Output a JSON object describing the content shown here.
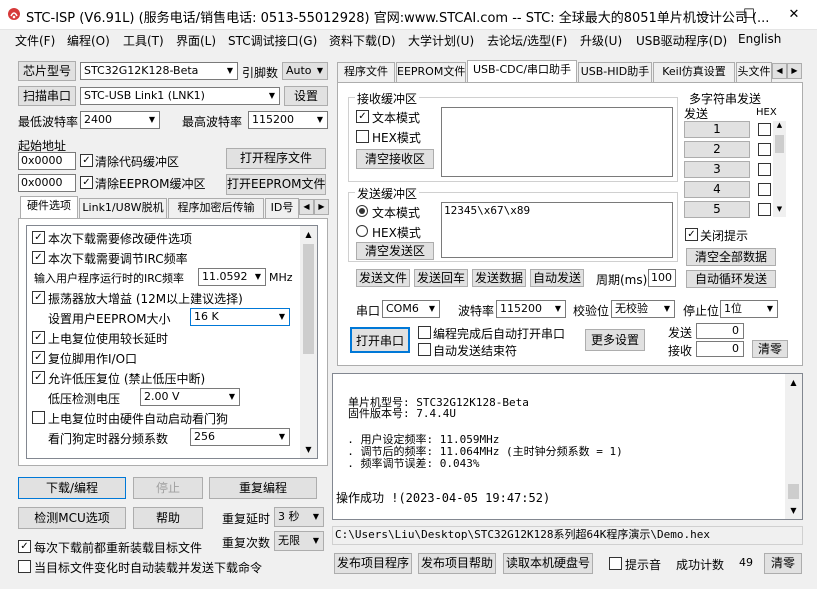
{
  "title": "STC-ISP (V6.91L) (服务电话/销售电话: 0513-55012928) 官网:www.STCAI.com -- STC: 全球最大的8051单片机设计公司 (...",
  "window_buttons": {
    "minimize": "—",
    "maximize": "☐",
    "close": "✕"
  },
  "menu": [
    "文件(F)",
    "编程(O)",
    "工具(T)",
    "界面(L)",
    "STC调试接口(G)",
    "资料下载(D)",
    "大学计划(U)",
    "去论坛/选型(F)",
    "升级(U)",
    "USB驱动程序(D)",
    "English"
  ],
  "left": {
    "chip_btn": "芯片型号",
    "chip_value": "STC32G12K128-Beta",
    "pin_label": "引脚数",
    "pin_value": "Auto",
    "scan_btn": "扫描串口",
    "port_value": "STC-USB Link1 (LNK1)",
    "settings_btn": "设置",
    "min_baud_label": "最低波特率",
    "min_baud": "2400",
    "max_baud_label": "最高波特率",
    "max_baud": "115200",
    "start_addr_label": "起始地址",
    "addr1": "0x0000",
    "clear_code": "清除代码缓冲区",
    "open_prog": "打开程序文件",
    "addr2": "0x0000",
    "clear_eeprom": "清除EEPROM缓冲区",
    "open_eeprom": "打开EEPROM文件",
    "tabs": [
      "硬件选项",
      "Link1/U8W脱机",
      "程序加密后传输",
      "ID号"
    ],
    "options": [
      {
        "label": "本次下载需要修改硬件选项",
        "checked": true
      },
      {
        "label": "本次下载需要调节IRC频率",
        "checked": true
      },
      {
        "label": "输入用户程序运行时的IRC频率",
        "value": "11.0592",
        "unit": "MHz"
      },
      {
        "label": "振荡器放大增益 (12M以上建议选择)",
        "checked": true
      },
      {
        "label": "设置用户EEPROM大小",
        "value": "16   K"
      },
      {
        "label": "上电复位使用较长延时",
        "checked": true
      },
      {
        "label": "复位脚用作I/O口",
        "checked": true
      },
      {
        "label": "允许低压复位 (禁止低压中断)",
        "checked": true
      },
      {
        "label": "低压检测电压",
        "value": "2.00 V"
      },
      {
        "label": "上电复位时由硬件自动启动看门狗",
        "checked": false
      },
      {
        "label": "看门狗定时器分频系数",
        "value": "256"
      }
    ],
    "download_btn": "下载/编程",
    "stop_btn": "停止",
    "reprogram_btn": "重复编程",
    "detect_btn": "检测MCU选项",
    "help_btn": "帮助",
    "repeat_delay_label": "重复延时",
    "repeat_delay": "3 秒",
    "repeat_count_label": "重复次数",
    "repeat_count": "无限",
    "reload_label": "每次下载前都重新装载目标文件",
    "reload_checked": true,
    "autoload_label": "当目标文件变化时自动装载并发送下载命令",
    "autoload_checked": false
  },
  "right": {
    "tabs": [
      "程序文件",
      "EEPROM文件",
      "USB-CDC/串口助手",
      "USB-HID助手",
      "Keil仿真设置",
      "头文件"
    ],
    "recv_group": "接收缓冲区",
    "text_mode": "文本模式",
    "hex_mode": "HEX模式",
    "clear_recv": "清空接收区",
    "send_group": "发送缓冲区",
    "send_text": "12345\\x67\\x89",
    "clear_send": "清空发送区",
    "send_file": "发送文件",
    "send_return": "发送回车",
    "send_data": "发送数据",
    "auto_send": "自动发送",
    "period_label": "周期(ms)",
    "period": "100",
    "multi_title": "多字符串发送",
    "send_col": "发送",
    "hex_col": "HEX",
    "multi_btns": [
      "1",
      "2",
      "3",
      "4",
      "5"
    ],
    "close_tip": "关闭提示",
    "clear_all": "清空全部数据",
    "auto_loop": "自动循环发送",
    "port_label": "串口",
    "port": "COM6",
    "baud_label": "波特率",
    "baud": "115200",
    "parity_label": "校验位",
    "parity": "无校验",
    "stop_label": "停止位",
    "stop": "1位",
    "open_port": "打开串口",
    "auto_open": "编程完成后自动打开串口",
    "auto_end": "自动发送结束符",
    "more_settings": "更多设置",
    "send_count_label": "发送",
    "send_count": "0",
    "recv_count_label": "接收",
    "recv_count": "0",
    "clear_count": "清零"
  },
  "log": {
    "lines": [
      "单片机型号: STC32G12K128-Beta",
      "固件版本号: 7.4.4U",
      "",
      "",
      "  . 用户设定频率: 11.059MHz",
      "  . 调节后的频率: 11.064MHz (主时钟分频系数 = 1)",
      "  . 频率调节误差: 0.043%"
    ],
    "result": "操作成功 !(2023-04-05 19:47:52)"
  },
  "path": "C:\\Users\\Liu\\Desktop\\STC32G12K128系列超64K程序演示\\Demo.hex",
  "bottom": {
    "publish_prog": "发布项目程序",
    "publish_help": "发布项目帮助",
    "read_disk": "读取本机硬盘号",
    "beep_label": "提示音",
    "success_label": "成功计数",
    "success_count": "49",
    "clear": "清零"
  }
}
